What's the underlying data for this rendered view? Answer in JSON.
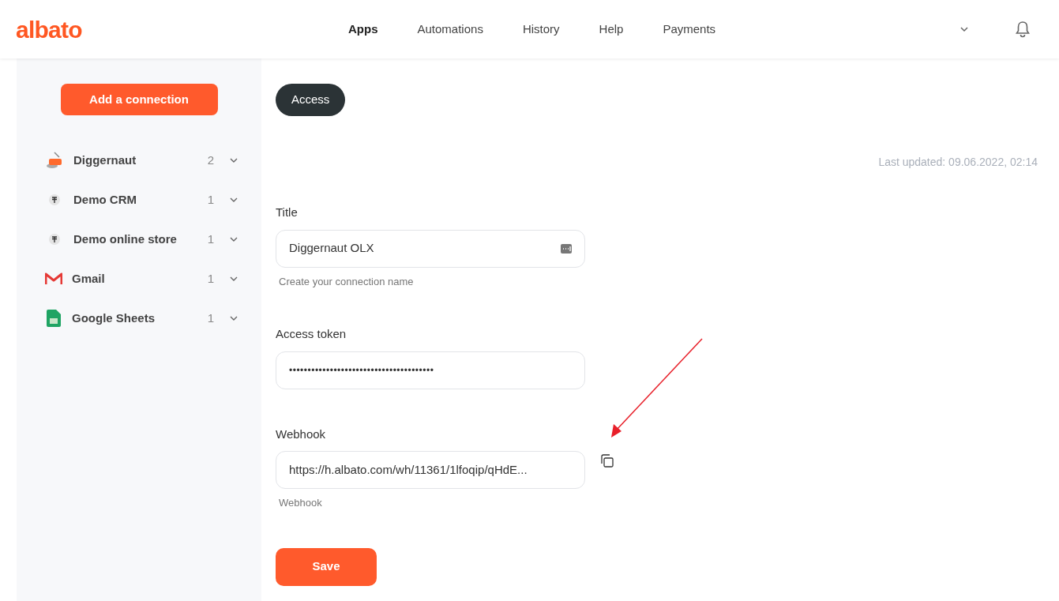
{
  "header": {
    "logo": "albato",
    "nav": [
      {
        "label": "Apps",
        "selected": true
      },
      {
        "label": "Automations",
        "selected": false
      },
      {
        "label": "History",
        "selected": false
      },
      {
        "label": "Help",
        "selected": false
      },
      {
        "label": "Payments",
        "selected": false
      }
    ]
  },
  "sidebar": {
    "add_button": "Add a connection",
    "items": [
      {
        "kind": "dig",
        "name": "Diggernaut",
        "count": "2"
      },
      {
        "kind": "demo",
        "name": "Demo CRM",
        "count": "1"
      },
      {
        "kind": "demo",
        "name": "Demo online store",
        "count": "1"
      },
      {
        "kind": "gmail",
        "name": "Gmail",
        "count": "1"
      },
      {
        "kind": "sheets",
        "name": "Google Sheets",
        "count": "1"
      }
    ]
  },
  "tabs": [
    {
      "label": "Access",
      "selected": true
    }
  ],
  "last_updated": "Last updated: 09.06.2022, 02:14",
  "form": {
    "fields": [
      {
        "kind": "text",
        "label": "Title",
        "value": "Diggernaut OLX",
        "hint": "Create your connection name"
      },
      {
        "kind": "secret",
        "label": "Access token",
        "value": "•••••••••••••••••••••••••••••••••••••••"
      },
      {
        "kind": "copy",
        "label": "Webhook",
        "value": "https://h.albato.com/wh/11361/1lfoqip/qHdE...",
        "hint": "Webhook"
      }
    ],
    "save_button": "Save"
  }
}
